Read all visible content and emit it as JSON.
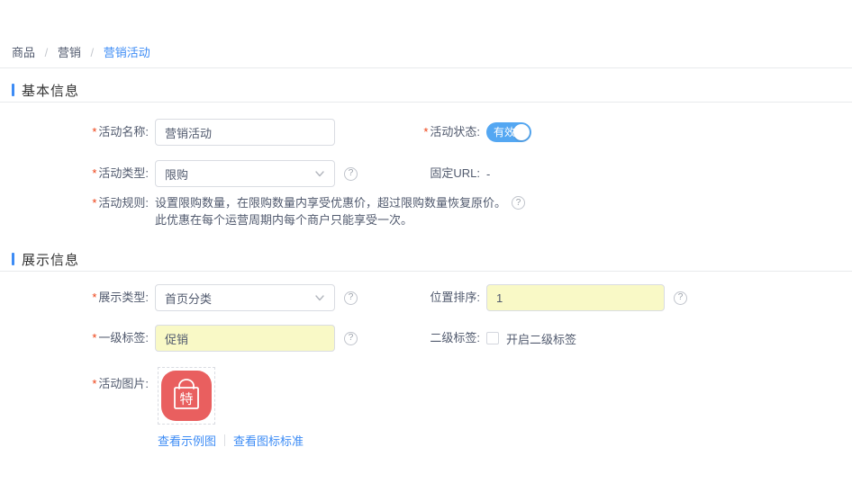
{
  "colors": {
    "accent": "#3d8cf5",
    "toggle_on": "#54a7f2",
    "highlight_input_bg": "#f9f9c6",
    "image_icon_bg": "#e95f5f",
    "required_mark": "#ed4014"
  },
  "icons": {
    "help": "?",
    "required_mark": "*"
  },
  "breadcrumb": {
    "separator": "/",
    "items": [
      "商品",
      "营销",
      "营销活动"
    ]
  },
  "basic_section": {
    "title": "基本信息",
    "activity_name": {
      "label": "活动名称:",
      "value": "营销活动"
    },
    "activity_status": {
      "label": "活动状态:",
      "value": "有效",
      "state": "on"
    },
    "activity_type": {
      "label": "活动类型:",
      "value": "限购"
    },
    "fixed_url": {
      "label": "固定URL:",
      "value": "-"
    },
    "activity_rule": {
      "label": "活动规则:",
      "line1": "设置限购数量，在限购数量内享受优惠价，超过限购数量恢复原价。",
      "line2": "此优惠在每个运营周期内每个商户只能享受一次。"
    }
  },
  "display_section": {
    "title": "展示信息",
    "display_type": {
      "label": "展示类型:",
      "value": "首页分类"
    },
    "position_sort": {
      "label": "位置排序:",
      "value": "1"
    },
    "primary_tag": {
      "label": "一级标签:",
      "value": "促销"
    },
    "secondary_tag": {
      "label": "二级标签:",
      "checkbox_label": "开启二级标签",
      "checked": false
    },
    "activity_image": {
      "label": "活动图片:",
      "badge_char": "特",
      "links": [
        "查看示例图",
        "查看图标标准"
      ]
    }
  }
}
